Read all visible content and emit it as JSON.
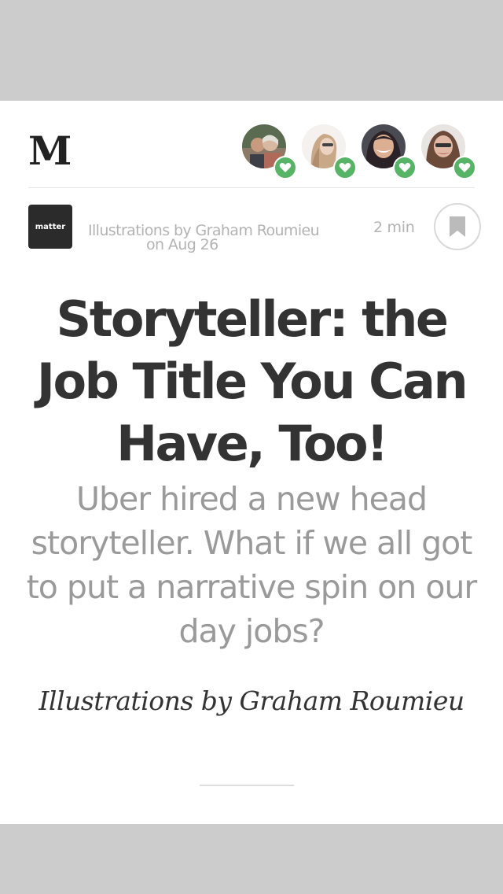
{
  "header": {
    "logo_text": "M",
    "avatars": [
      {
        "name": "avatar-1",
        "icon": "heart-icon"
      },
      {
        "name": "avatar-2",
        "icon": "heart-icon"
      },
      {
        "name": "avatar-3",
        "icon": "heart-icon"
      },
      {
        "name": "avatar-4",
        "icon": "heart-icon"
      }
    ]
  },
  "meta": {
    "publication_logo_text": "matter",
    "byline": "Illustrations by Graham Roumieu",
    "date": "on Aug 26",
    "read_time": "2 min",
    "bookmark_icon": "bookmark-icon"
  },
  "article": {
    "title": "Storyteller: the Job Title You Can Have, Too!",
    "subtitle": "Uber hired a new head storyteller. What if we all got to put a narrative spin on our day jobs?",
    "credit": "Illustrations by Graham Roumieu"
  },
  "colors": {
    "heart_badge": "#57b366",
    "background_band": "#cccccc",
    "title": "#333333",
    "subtitle": "#9a9a9a"
  }
}
